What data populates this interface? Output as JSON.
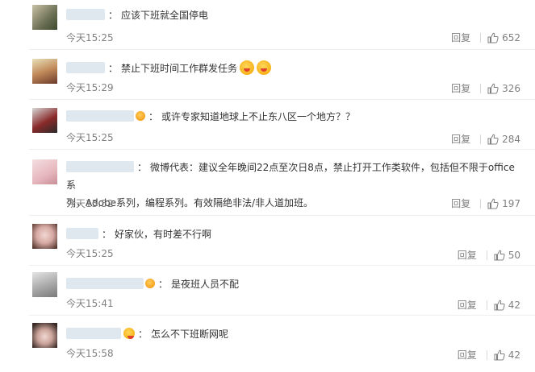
{
  "comments": [
    {
      "text": "应该下班就全国停电",
      "time": "今天15:25",
      "reply": "回复",
      "likes": "652",
      "emoji": 0,
      "vip": false,
      "user_width": 48
    },
    {
      "text": "禁止下班时间工作群发任务",
      "time": "今天15:29",
      "reply": "回复",
      "likes": "326",
      "emoji": 2,
      "vip": false,
      "user_width": 48
    },
    {
      "text": "或许专家知道地球上不止东八区一个地方？？",
      "time": "今天15:25",
      "reply": "回复",
      "likes": "284",
      "vip": true
    },
    {
      "text_line1": "微博代表：建议全年晚间22点至次日8点，禁止打开工作类软件，包括但不限于office系",
      "text_line2": "列，Adobe系列，编程系列。有效隔绝非法/非人道加班。",
      "time": "今天15:52",
      "reply": "回复",
      "likes": "197"
    },
    {
      "text": "好家伙，有时差不行啊",
      "time": "今天15:25",
      "reply": "回复",
      "likes": "50"
    },
    {
      "text": "是夜班人员不配",
      "time": "今天15:41",
      "reply": "回复",
      "likes": "42",
      "vip": true
    },
    {
      "text": "怎么不下班断网呢",
      "time": "今天15:58",
      "reply": "回复",
      "likes": "42",
      "vip": true
    }
  ],
  "colors": {
    "text": "#333333",
    "meta": "#808080",
    "divider": "#eeeeee"
  }
}
